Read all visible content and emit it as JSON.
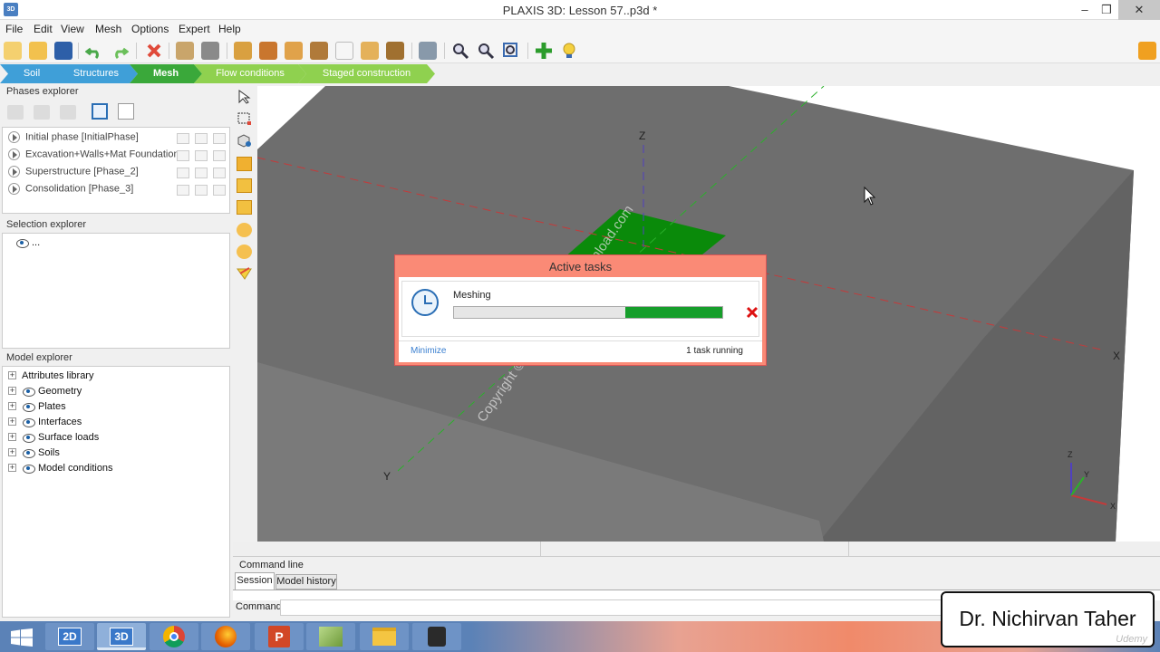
{
  "window": {
    "title": "PLAXIS 3D: Lesson 57..p3d *",
    "app_icon_label": "3D",
    "controls": [
      "–",
      "❒",
      "✕"
    ]
  },
  "menu": [
    "File",
    "Edit",
    "View",
    "Mesh",
    "Options",
    "Expert",
    "Help"
  ],
  "modes": {
    "items": [
      "Soil",
      "Structures",
      "Mesh",
      "Flow conditions",
      "Staged construction"
    ],
    "active": "Mesh",
    "colors": [
      "#3f9fd8",
      "#3f9fd8",
      "#3aa83a",
      "#8fd14f",
      "#8fd14f"
    ]
  },
  "phases_explorer": {
    "title": "Phases explorer",
    "phases": [
      "Initial phase [InitialPhase]",
      "Excavation+Walls+Mat Foundation",
      "Superstructure [Phase_2]",
      "Consolidation [Phase_3]"
    ]
  },
  "selection_explorer": {
    "title": "Selection explorer",
    "item": "..."
  },
  "model_explorer": {
    "title": "Model explorer",
    "items": [
      "Attributes library",
      "Geometry",
      "Plates",
      "Interfaces",
      "Surface loads",
      "Soils",
      "Model conditions"
    ]
  },
  "viewport": {
    "axis_x": "X",
    "axis_y": "Y",
    "axis_z": "Z",
    "mini_axes": {
      "z": "Z",
      "y": "Y",
      "x": "X"
    },
    "watermark": "Copyright © 2025 - www.p30download.com"
  },
  "active_tasks": {
    "title": "Active tasks",
    "task_name": "Meshing",
    "progress": 0.36,
    "minimize_label": "Minimize",
    "status": "1 task running"
  },
  "command_line": {
    "title": "Command line",
    "tabs": [
      "Session",
      "Model history"
    ],
    "active_tab": "Session",
    "prompt_label": "Command"
  },
  "overlay": {
    "presenter": "Dr. Nichirvan Taher",
    "brand": "Udemy"
  },
  "taskbar": {
    "items": [
      "start-button",
      "plaxis-2d",
      "plaxis-3d",
      "chrome",
      "firefox",
      "powerpoint",
      "app-green",
      "file-explorer",
      "camera-app"
    ],
    "labels": {
      "2d": "2D",
      "3d": "3D"
    }
  }
}
